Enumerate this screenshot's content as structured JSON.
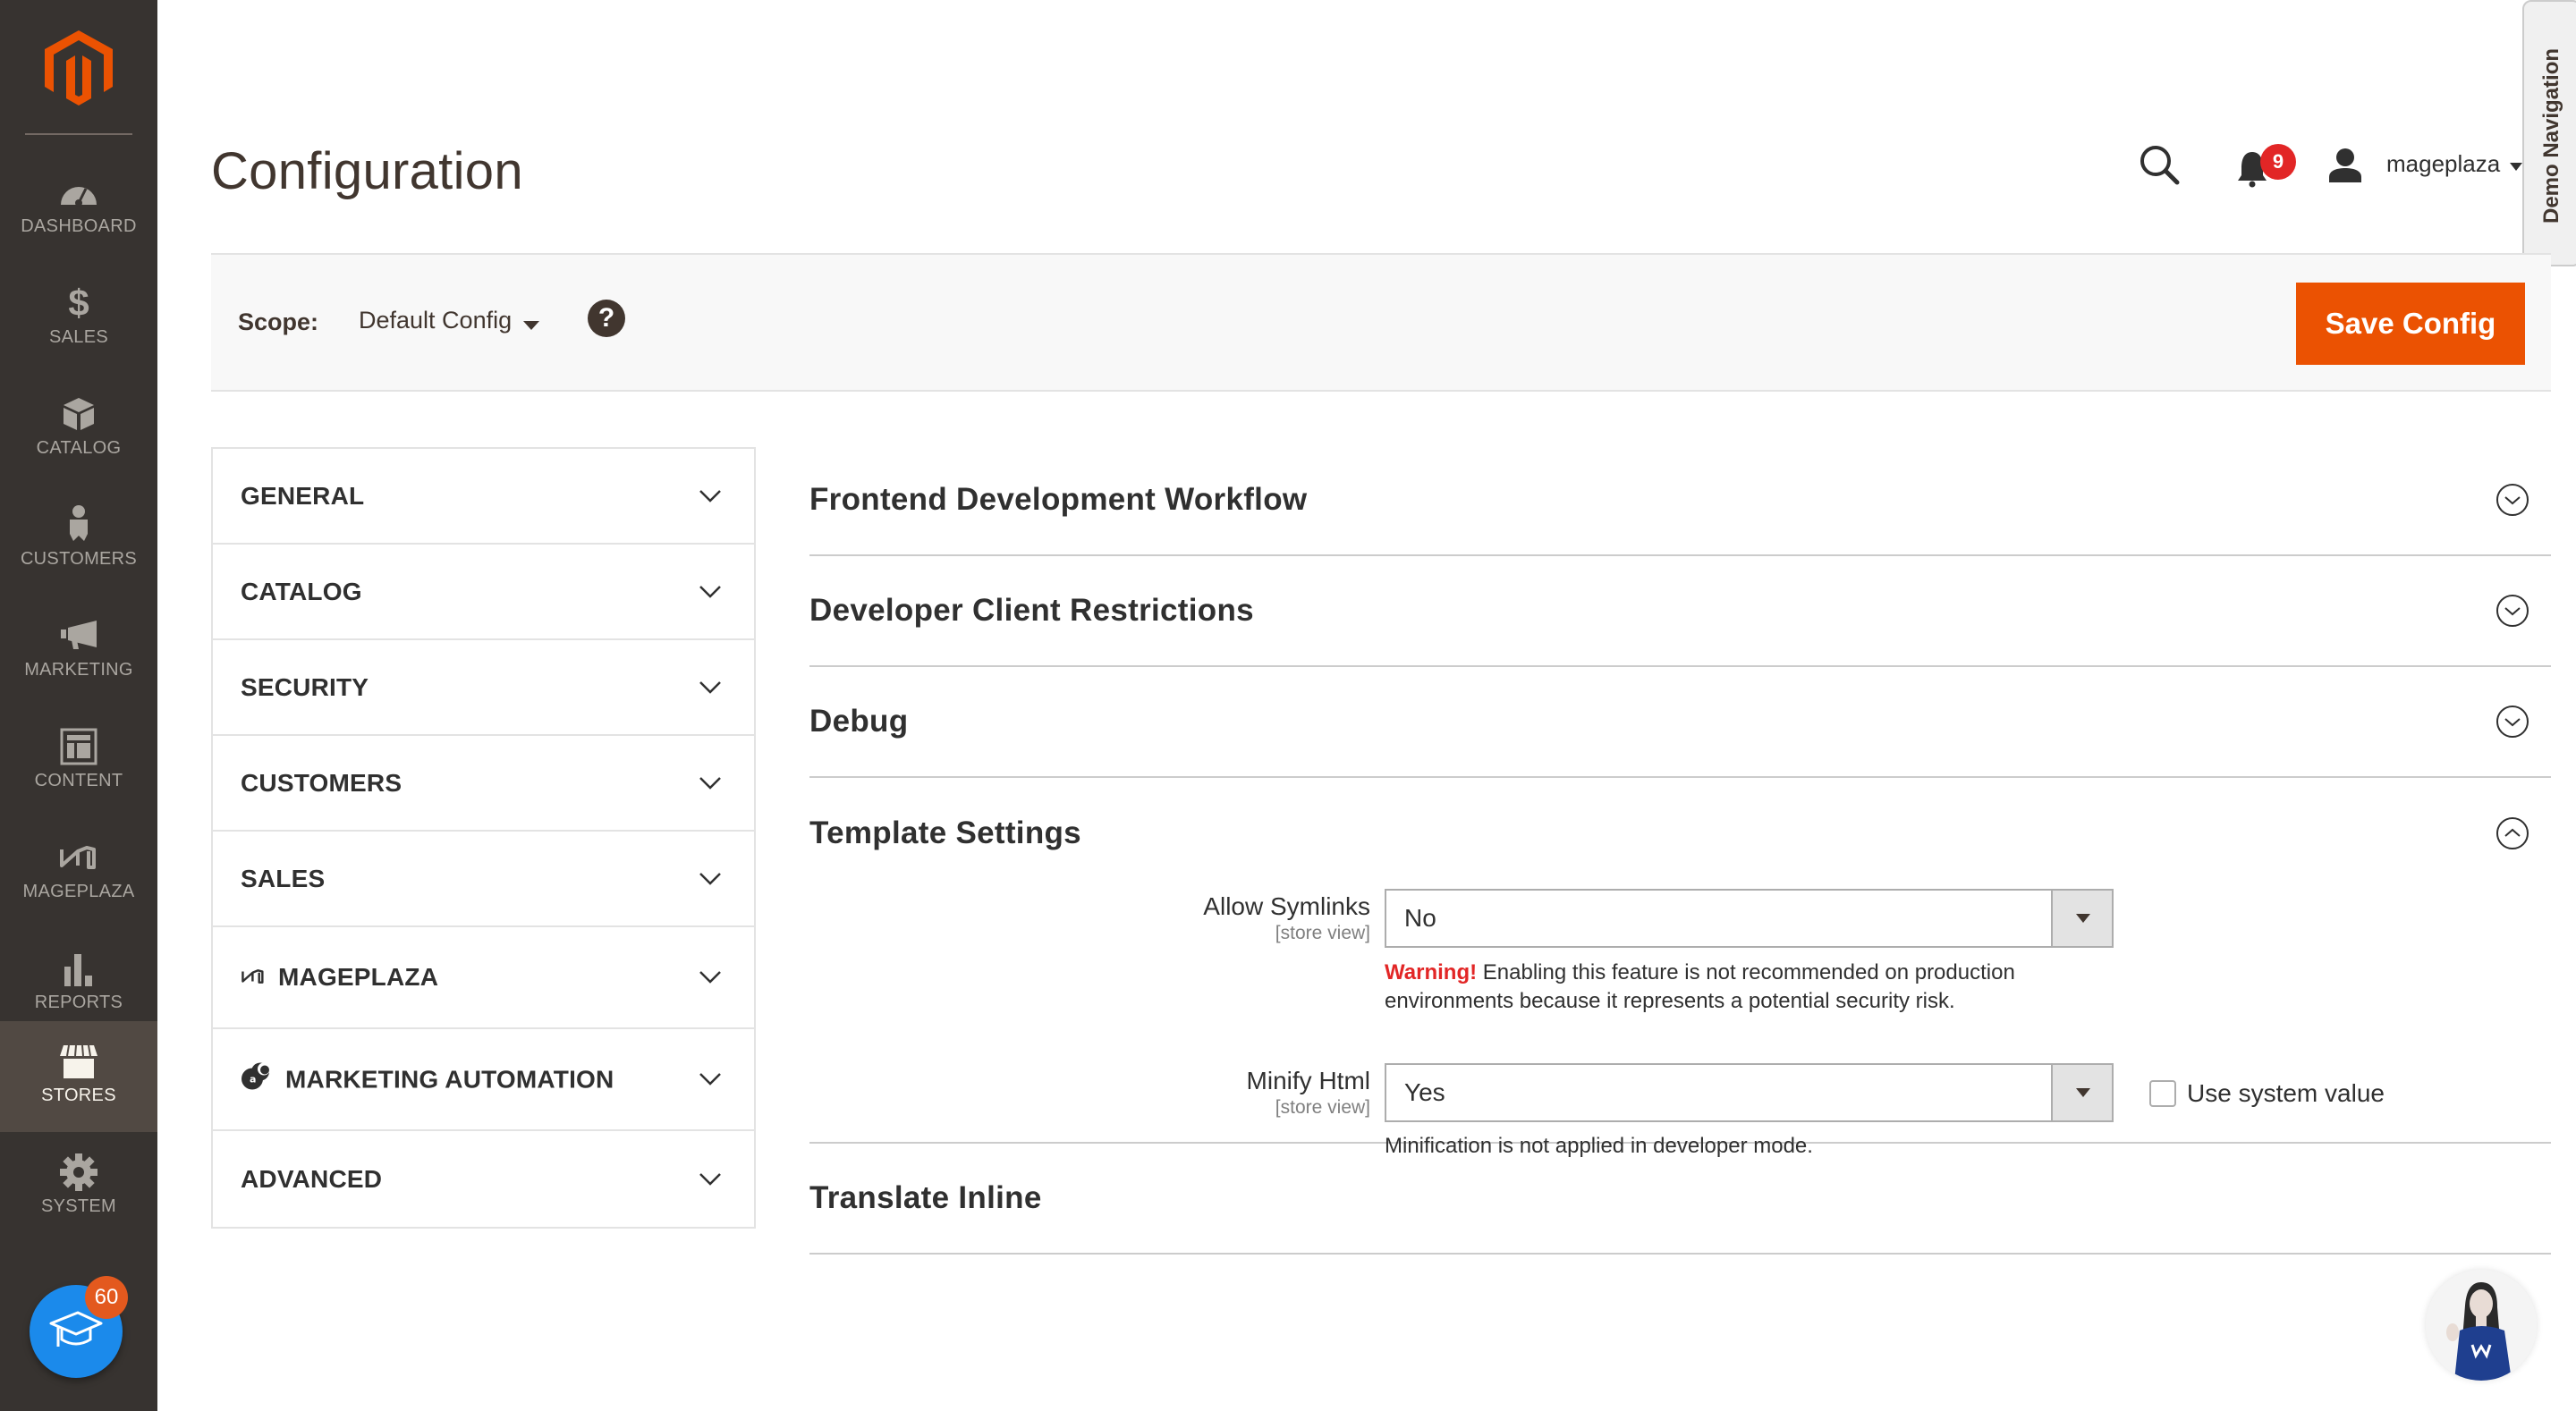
{
  "sidebar": {
    "logo": "magento-logo",
    "items": [
      {
        "label": "DASHBOARD",
        "icon": "dashboard-icon",
        "active": false
      },
      {
        "label": "SALES",
        "icon": "dollar-icon",
        "active": false
      },
      {
        "label": "CATALOG",
        "icon": "box-icon",
        "active": false
      },
      {
        "label": "CUSTOMERS",
        "icon": "person-icon",
        "active": false
      },
      {
        "label": "MARKETING",
        "icon": "megaphone-icon",
        "active": false
      },
      {
        "label": "CONTENT",
        "icon": "layout-icon",
        "active": false
      },
      {
        "label": "MAGEPLAZA",
        "icon": "mageplaza-icon",
        "active": false
      },
      {
        "label": "REPORTS",
        "icon": "bar-chart-icon",
        "active": false
      },
      {
        "label": "STORES",
        "icon": "store-icon",
        "active": true
      },
      {
        "label": "SYSTEM",
        "icon": "gear-icon",
        "active": false
      }
    ],
    "academy_badge": "60"
  },
  "header": {
    "title": "Configuration",
    "notifications_count": "9",
    "username": "mageplaza",
    "demo_nav_label": "Demo Navigation"
  },
  "scope_bar": {
    "label": "Scope:",
    "value": "Default Config",
    "help": "?",
    "save_label": "Save Config"
  },
  "tabs": [
    {
      "label": "GENERAL"
    },
    {
      "label": "CATALOG"
    },
    {
      "label": "SECURITY"
    },
    {
      "label": "CUSTOMERS"
    },
    {
      "label": "SALES"
    },
    {
      "label": "MAGEPLAZA",
      "icon": "mageplaza-icon"
    },
    {
      "label": "MARKETING AUTOMATION",
      "icon": "marketing-automation-icon"
    },
    {
      "label": "ADVANCED"
    }
  ],
  "sections": [
    {
      "title": "Frontend Development Workflow",
      "expanded": false
    },
    {
      "title": "Developer Client Restrictions",
      "expanded": false
    },
    {
      "title": "Debug",
      "expanded": false
    },
    {
      "title": "Template Settings",
      "expanded": true
    },
    {
      "title": "Translate Inline",
      "expanded": false
    }
  ],
  "template_settings": {
    "allow_symlinks": {
      "label": "Allow Symlinks",
      "scope": "[store view]",
      "value": "No",
      "warning_prefix": "Warning!",
      "warning_text": " Enabling this feature is not recommended on production environments because it represents a potential security risk."
    },
    "minify_html": {
      "label": "Minify Html",
      "scope": "[store view]",
      "value": "Yes",
      "note": "Minification is not applied in developer mode.",
      "use_system_value_label": "Use system value",
      "use_system_value_checked": false
    }
  },
  "colors": {
    "accent": "#eb5202",
    "sidebar_bg": "#373330",
    "sidebar_active": "#514943",
    "warning": "#e22626",
    "academy": "#1b8aeb"
  }
}
